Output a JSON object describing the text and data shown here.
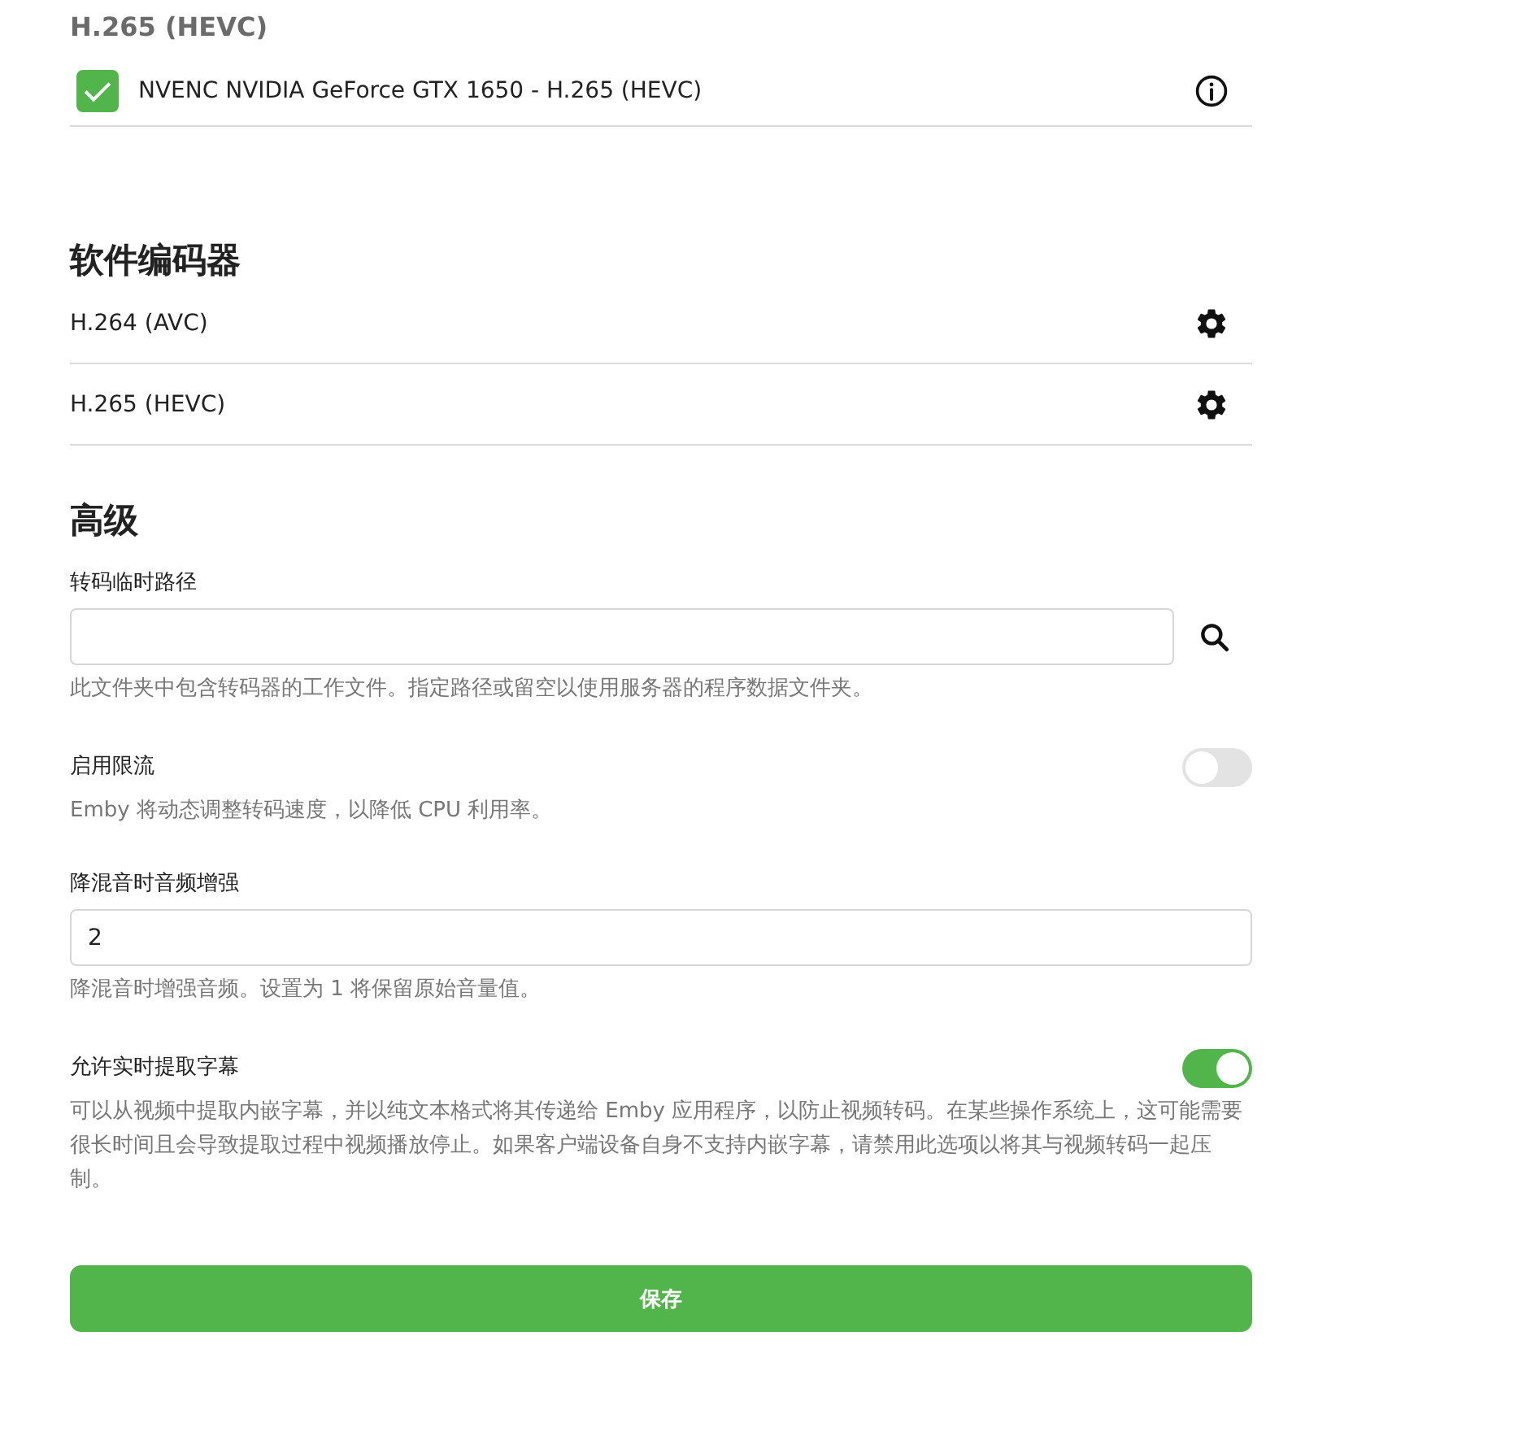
{
  "hardware_section": {
    "title": "H.265 (HEVC)",
    "items": [
      {
        "label": "NVENC NVIDIA GeForce GTX 1650 - H.265 (HEVC)",
        "checked": true
      }
    ]
  },
  "software_section": {
    "title": "软件编码器",
    "items": [
      {
        "label": "H.264 (AVC)"
      },
      {
        "label": "H.265 (HEVC)"
      }
    ]
  },
  "advanced_section": {
    "title": "高级",
    "settings": [
      {
        "kind": "path",
        "label": "转码临时路径",
        "help": "此文件夹中包含转码器的工作文件。指定路径或留空以使用服务器的程序数据文件夹。"
      },
      {
        "kind": "toggle",
        "label": "启用限流",
        "on": false,
        "help": "Emby 将动态调整转码速度，以降低 CPU 利用率。"
      },
      {
        "kind": "text",
        "label": "降混音时音频增强",
        "value": "2",
        "help": "降混音时增强音频。设置为 1 将保留原始音量值。"
      },
      {
        "kind": "toggle",
        "label": "允许实时提取字幕",
        "on": true,
        "help": "可以从视频中提取内嵌字幕，并以纯文本格式将其传递给 Emby 应用程序，以防止视频转码。在某些操作系统上，这可能需要很长时间且会导致提取过程中视频播放停止。如果客户端设备自身不支持内嵌字幕，请禁用此选项以将其与视频转码一起压制。"
      }
    ]
  },
  "save_button": {
    "label": "保存"
  }
}
